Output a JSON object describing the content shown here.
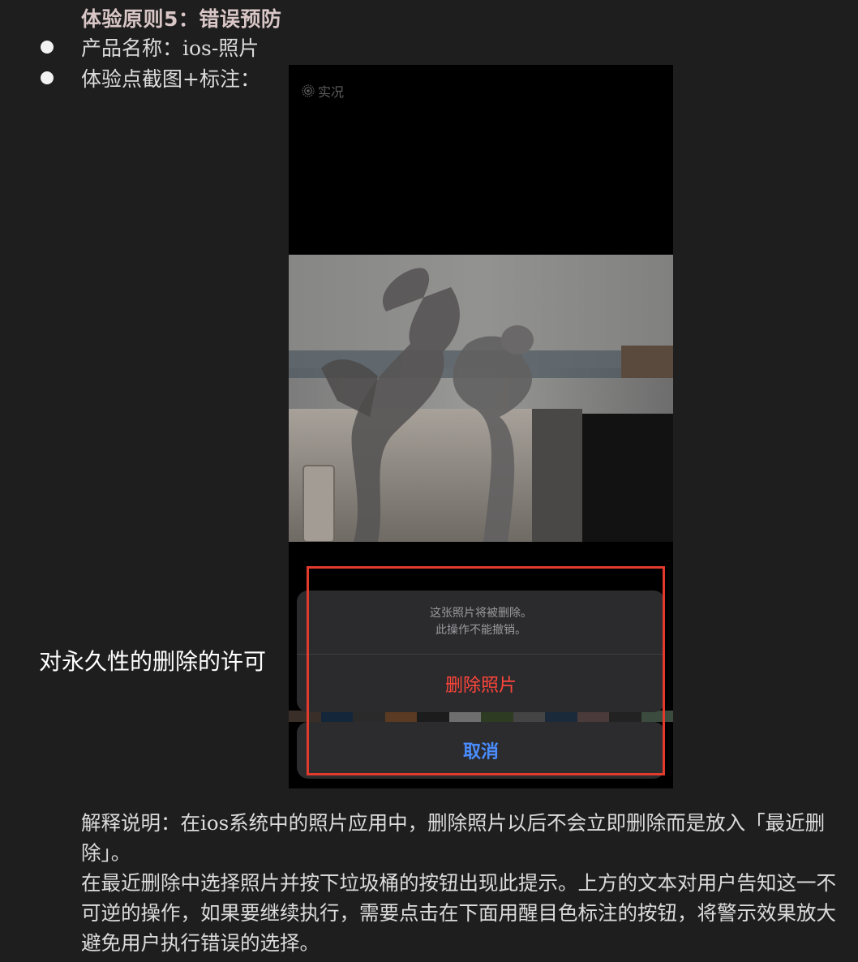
{
  "heading": "体验原则5：错误预防",
  "bullets": [
    "产品名称：ios-照片",
    "体验点截图+标注："
  ],
  "side_label": "对永久性的删除的许可",
  "screenshot": {
    "live_label": "实况",
    "sheet_message_line1": "这张照片将被删除。",
    "sheet_message_line2": "此操作不能撤销。",
    "delete_label": "删除照片",
    "cancel_label": "取消",
    "colors": {
      "delete": "#ff453a",
      "cancel": "#4a8dff",
      "annotation_box": "#e23b2e"
    }
  },
  "explanation": {
    "line1": "解释说明：在ios系统中的照片应用中，删除照片以后不会立即删除而是放入「最近删除」。",
    "line2": "在最近删除中选择照片并按下垃圾桶的按钮出现此提示。上方的文本对用户告知这一不可逆的操作，如果要继续执行，需要点击在下面用醒目色标注的按钮，将警示效果放大避免用户执行错误的选择。"
  }
}
